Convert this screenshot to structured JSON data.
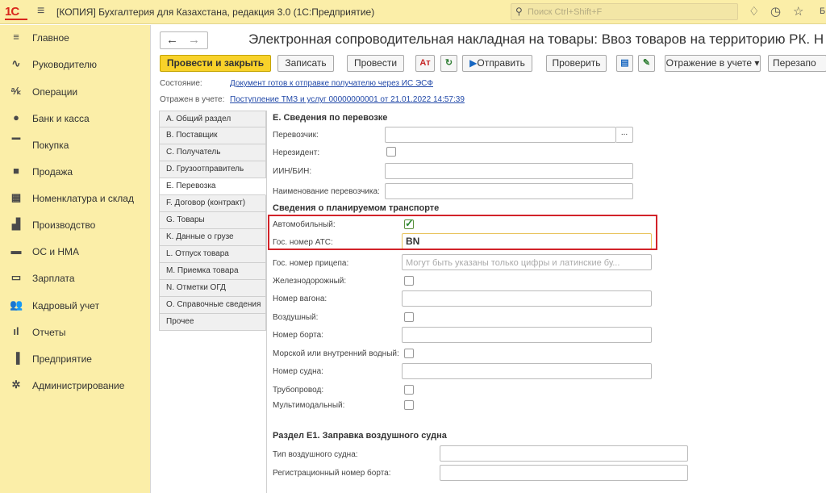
{
  "titlebar": {
    "logo": "1С",
    "title": "[КОПИЯ] Бухгалтерия для Казахстана, редакция 3.0  (1С:Предприятие)",
    "search_placeholder": "Поиск Ctrl+Shift+F",
    "clipped_text": "Б"
  },
  "sidebar": {
    "items": [
      {
        "label": "Главное",
        "icon": "menu-icon",
        "glyph": "≡"
      },
      {
        "label": "Руководителю",
        "icon": "trend-icon",
        "glyph": "∿"
      },
      {
        "label": "Операции",
        "icon": "operations-icon",
        "glyph": "ᵃ⁄ₖ"
      },
      {
        "label": "Банк и касса",
        "icon": "coin-icon",
        "glyph": "●"
      },
      {
        "label": "Покупка",
        "icon": "cart-icon",
        "glyph": "▔"
      },
      {
        "label": "Продажа",
        "icon": "bag-icon",
        "glyph": "■"
      },
      {
        "label": "Номенклатура и склад",
        "icon": "warehouse-icon",
        "glyph": "▦"
      },
      {
        "label": "Производство",
        "icon": "factory-icon",
        "glyph": "▟"
      },
      {
        "label": "ОС и НМА",
        "icon": "truck-icon",
        "glyph": "▬"
      },
      {
        "label": "Зарплата",
        "icon": "money-icon",
        "glyph": "▭"
      },
      {
        "label": "Кадровый учет",
        "icon": "people-icon",
        "glyph": "👥"
      },
      {
        "label": "Отчеты",
        "icon": "report-icon",
        "glyph": "ıl"
      },
      {
        "label": "Предприятие",
        "icon": "building-icon",
        "glyph": "▐"
      },
      {
        "label": "Администрирование",
        "icon": "gear-icon",
        "glyph": "✲"
      }
    ]
  },
  "document": {
    "title": "Электронная сопроводительная накладная на товары: Ввоз товаров на территорию РК. Н"
  },
  "toolbar": {
    "post_close": "Провести и закрыть",
    "save": "Записать",
    "post": "Провести",
    "send": "Отправить",
    "check": "Проверить",
    "accounting": "Отражение в учете",
    "reorder": "Перезапо"
  },
  "status": {
    "state_label": "Состояние:",
    "state_value": "Документ готов к отправке получателю через ИС ЭСФ",
    "reflected_label": "Отражен в учете:",
    "reflected_value": "Поступление ТМЗ и услуг 00000000001 от 21.01.2022 14:57:39"
  },
  "tabs": [
    {
      "label": "A. Общий раздел"
    },
    {
      "label": "B. Поставщик"
    },
    {
      "label": "C. Получатель"
    },
    {
      "label": "D. Грузоотправитель"
    },
    {
      "label": "E. Перевозка"
    },
    {
      "label": "F. Договор (контракт)"
    },
    {
      "label": "G. Товары"
    },
    {
      "label": "K. Данные о грузе"
    },
    {
      "label": "L. Отпуск товара"
    },
    {
      "label": "M. Приемка товара"
    },
    {
      "label": "N. Отметки ОГД"
    },
    {
      "label": "O. Справочные сведения"
    },
    {
      "label": "Прочее"
    }
  ],
  "form": {
    "section_e": "E. Сведения по перевозке",
    "carrier_label": "Перевозчик:",
    "carrier_select": "...",
    "nonresident_label": "Нерезидент:",
    "iin_label": "ИИН/БИН:",
    "carrier_name_label": "Наименование перевозчика:",
    "transport_section": "Сведения о планируемом транспорте",
    "auto_label": "Автомобильный:",
    "auto_plate_label": "Гос. номер АТС:",
    "auto_plate_value": "BN",
    "trailer_label": "Гос. номер прицепа:",
    "trailer_placeholder": "Могут быть указаны только цифры и латинские бу...",
    "rail_label": "Железнодорожный:",
    "wagon_label": "Номер вагона:",
    "air_label": "Воздушный:",
    "board_label": "Номер борта:",
    "sea_label": "Морской или внутренний водный:",
    "vessel_label": "Номер судна:",
    "pipeline_label": "Трубопровод:",
    "multimodal_label": "Мультимодальный:",
    "section_e1": "Раздел E1. Заправка воздушного судна",
    "aircraft_type_label": "Тип воздушного судна:",
    "reg_number_label": "Регистрационный номер борта:"
  }
}
